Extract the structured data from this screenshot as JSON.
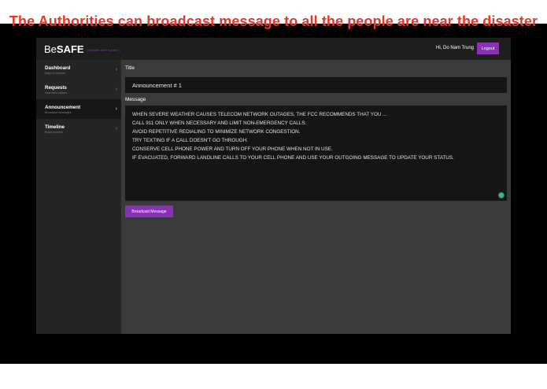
{
  "caption": "The Authorities can broadcast message to all the people are near the disaster",
  "header": {
    "brand_prefix": "Be",
    "brand_main": "SAFE",
    "brand_tagline": "( Disaster Alert System )",
    "greeting": "Hi, Do Nam Trung",
    "logout_label": "Logout"
  },
  "sidebar": {
    "items": [
      {
        "title": "Dashboard",
        "subtitle": "Maps & Number",
        "active": false
      },
      {
        "title": "Requests",
        "subtitle": "Hear from victims",
        "active": false
      },
      {
        "title": "Announcement",
        "subtitle": "Broadcast messages",
        "active": true
      },
      {
        "title": "Timeline",
        "subtitle": "Event timeline",
        "active": false
      }
    ],
    "chevron": "›"
  },
  "form": {
    "title_label": "Title",
    "title_value": "Announcement # 1",
    "message_label": "Message",
    "message_lines": [
      "WHEN SEVERE WEATHER CAUSES TELECOM NETWORK OUTAGES, THE FCC RECOMMENDS THAT YOU ...",
      "CALL 911 ONLY WHEN NECESSARY AND LIMIT NON-EMERGENCY CALLS.",
      "AVOID REPETITIVE REDIALING TO MINIMIZE NETWORK CONGESTION.",
      "TRY TEXTING IF A CALL DOESN'T GO THROUGH.",
      "CONSERVE CELL PHONE POWER AND TURN OFF YOUR PHONE WHEN NOT IN USE.",
      "IF EVACUATED, FORWARD LANDLINE CALLS TO YOUR CELL PHONE AND USE YOUR OUTGOING MESSAGE TO UPDATE YOUR STATUS."
    ],
    "submit_label": "Broadcast Message"
  },
  "colors": {
    "caption": "#e8362b",
    "accent": "#8a2fb8",
    "background": "#3a3a3a",
    "sidebar": "#252525",
    "topbar": "#1e1e1e"
  }
}
